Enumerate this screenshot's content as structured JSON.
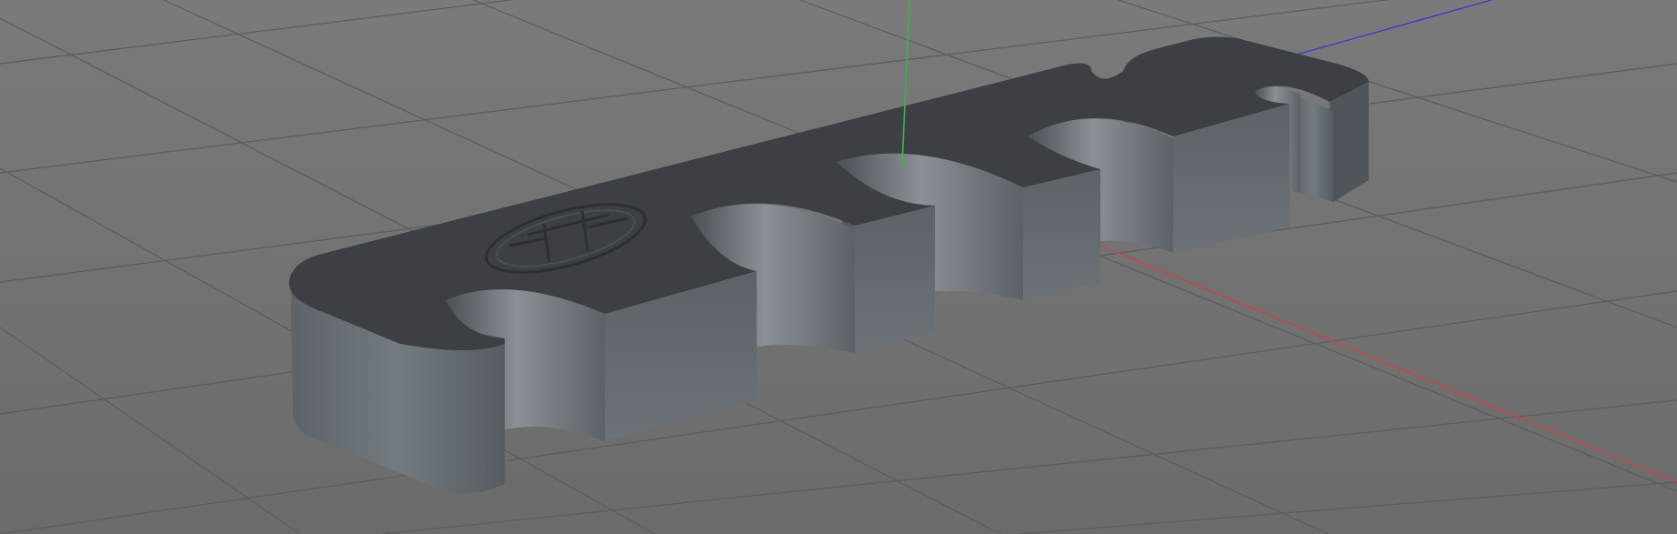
{
  "viewport": {
    "background_color": "#717171",
    "grid_color": "#5e5e5e",
    "grid_visible": true
  },
  "axes": {
    "x_color": "#c63a3a",
    "y_color": "#3ab03a",
    "z_color": "#3a3ac8"
  },
  "model": {
    "kind": "cable-clip-holder",
    "slots": 5,
    "top_color": "#3b3f42",
    "side_color": "#666c71",
    "inner_color": "#7a8085",
    "engraved_logo": true
  }
}
